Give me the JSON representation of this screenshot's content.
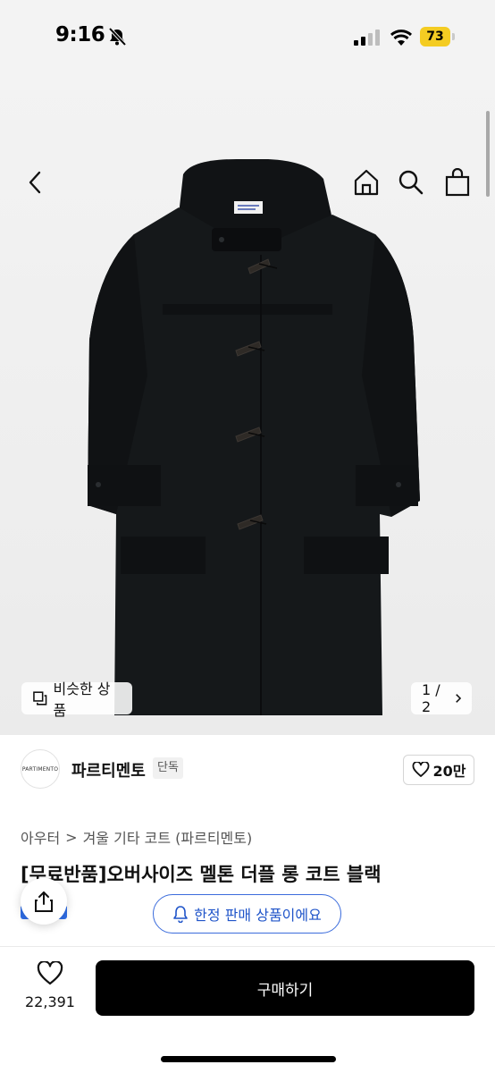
{
  "status": {
    "time": "9:16",
    "battery": "73"
  },
  "hero": {
    "similar_label": "비슷한 상품",
    "pager": "1 / 2",
    "label_tag": "PARTIMENTO"
  },
  "brand": {
    "logo_text": "PARTIMENTO",
    "name": "파르티멘토",
    "badge": "단독",
    "likes": "20만"
  },
  "product": {
    "crumb_category": "아우터",
    "crumb_sep": ">",
    "crumb_sub": "겨울 기타 코트 (파르티멘토)",
    "title": "[무료반품]오버사이즈 멜톤 더플 롱 코트 블랙",
    "limited_notice": "한정 판매 상품이에요"
  },
  "bottom": {
    "wish_count": "22,391",
    "buy_label": "구매하기"
  },
  "colors": {
    "accent_blue": "#3b6cdc",
    "battery_yellow": "#f4cc22",
    "buy_bg": "#000000"
  }
}
